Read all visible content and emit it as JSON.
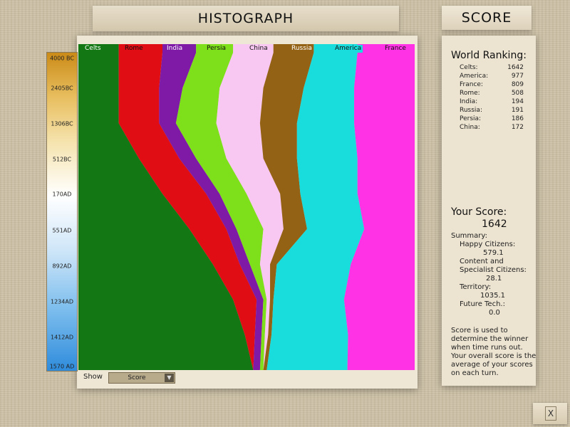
{
  "header": {
    "title": "HISTOGRAPH",
    "score_tab": "SCORE"
  },
  "timeline": [
    "4000 BC",
    "2405BC",
    "1306BC",
    "512BC",
    "170AD",
    "551AD",
    "892AD",
    "1234AD",
    "1412AD",
    "1570 AD"
  ],
  "civilizations": [
    {
      "name": "Celts",
      "color": "#137813",
      "text_color": "#ffffff"
    },
    {
      "name": "Rome",
      "color": "#e00d15",
      "text_color": "#111111"
    },
    {
      "name": "India",
      "color": "#7e1aa6",
      "text_color": "#ffffff"
    },
    {
      "name": "Persia",
      "color": "#7ee01a",
      "text_color": "#111111"
    },
    {
      "name": "China",
      "color": "#f8c8f2",
      "text_color": "#111111"
    },
    {
      "name": "Russia",
      "color": "#946214",
      "text_color": "#ffffff"
    },
    {
      "name": "America",
      "color": "#19dcdc",
      "text_color": "#111111"
    },
    {
      "name": "France",
      "color": "#ff32e6",
      "text_color": "#111111"
    }
  ],
  "chart_data": {
    "type": "area",
    "stacked": true,
    "normalized": true,
    "categories": [
      "4000 BC",
      "2405BC",
      "1306BC",
      "512BC",
      "170AD",
      "551AD",
      "892AD",
      "1234AD",
      "1412AD",
      "1570 AD"
    ],
    "series": [
      {
        "name": "Celts",
        "values": [
          12,
          12,
          12,
          18,
          25,
          33,
          40,
          46,
          50,
          52
        ]
      },
      {
        "name": "Rome",
        "values": [
          13,
          12,
          12,
          12,
          13,
          11,
          8,
          7,
          3,
          0
        ]
      },
      {
        "name": "India",
        "values": [
          10,
          7,
          5,
          5,
          4,
          3,
          3,
          2,
          2,
          2
        ]
      },
      {
        "name": "Persia",
        "values": [
          11,
          11,
          12,
          9,
          8,
          8,
          3,
          1,
          1,
          1
        ]
      },
      {
        "name": "China",
        "values": [
          12,
          13,
          13,
          11,
          10,
          6,
          3,
          1,
          1,
          0
        ]
      },
      {
        "name": "Russia",
        "values": [
          12,
          12,
          11,
          10,
          6,
          7,
          2,
          1,
          1,
          1
        ]
      },
      {
        "name": "America",
        "values": [
          13,
          15,
          17,
          18,
          17,
          17,
          22,
          21,
          23,
          24
        ]
      },
      {
        "name": "France",
        "values": [
          17,
          18,
          18,
          17,
          17,
          15,
          19,
          21,
          20,
          20
        ]
      }
    ]
  },
  "show": {
    "label": "Show",
    "value": "Score"
  },
  "ranking": {
    "title": "World Ranking:",
    "rows": [
      {
        "name": "Celts:",
        "value": "1642"
      },
      {
        "name": "America:",
        "value": "977"
      },
      {
        "name": "France:",
        "value": "809"
      },
      {
        "name": "Rome:",
        "value": "508"
      },
      {
        "name": "India:",
        "value": "194"
      },
      {
        "name": "Russia:",
        "value": "191"
      },
      {
        "name": "Persia:",
        "value": "186"
      },
      {
        "name": "China:",
        "value": "172"
      }
    ]
  },
  "your_score": {
    "title": "Your Score:",
    "value": "1642",
    "summary_label": "Summary:",
    "happy_label": "Happy Citizens:",
    "happy_value": "579.1",
    "content_label_1": "Content and",
    "content_label_2": "Specialist Citizens:",
    "content_value": "28.1",
    "territory_label": "Territory:",
    "territory_value": "1035.1",
    "future_label": "Future Tech.:",
    "future_value": "0.0",
    "note": [
      "Score is used to",
      "determine the winner",
      "when time runs out.",
      "Your overall score is the",
      "average of your scores",
      "on each turn."
    ]
  },
  "close_label": "X"
}
